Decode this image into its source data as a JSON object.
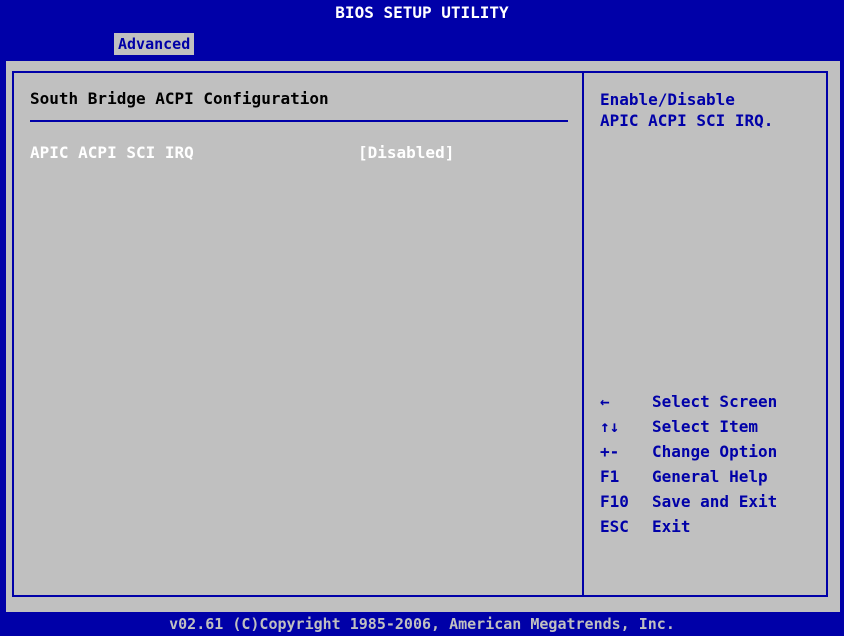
{
  "header": {
    "title": "BIOS SETUP UTILITY",
    "tab": "Advanced"
  },
  "section": {
    "title": "South Bridge ACPI Configuration"
  },
  "options": [
    {
      "label": "APIC ACPI SCI IRQ",
      "value": "[Disabled]"
    }
  ],
  "help": {
    "line1": "Enable/Disable",
    "line2": "APIC ACPI SCI IRQ."
  },
  "keys": [
    {
      "key": "←",
      "desc": "Select Screen"
    },
    {
      "key": "↑↓",
      "desc": "Select Item"
    },
    {
      "key": "+-",
      "desc": "Change Option"
    },
    {
      "key": "F1",
      "desc": "General Help"
    },
    {
      "key": "F10",
      "desc": "Save and Exit"
    },
    {
      "key": "ESC",
      "desc": "Exit"
    }
  ],
  "footer": {
    "text": "v02.61 (C)Copyright 1985-2006, American Megatrends, Inc."
  },
  "colors": {
    "bios_blue": "#0000a8",
    "panel_gray": "#c0c0c0",
    "text_white": "#ffffff"
  }
}
